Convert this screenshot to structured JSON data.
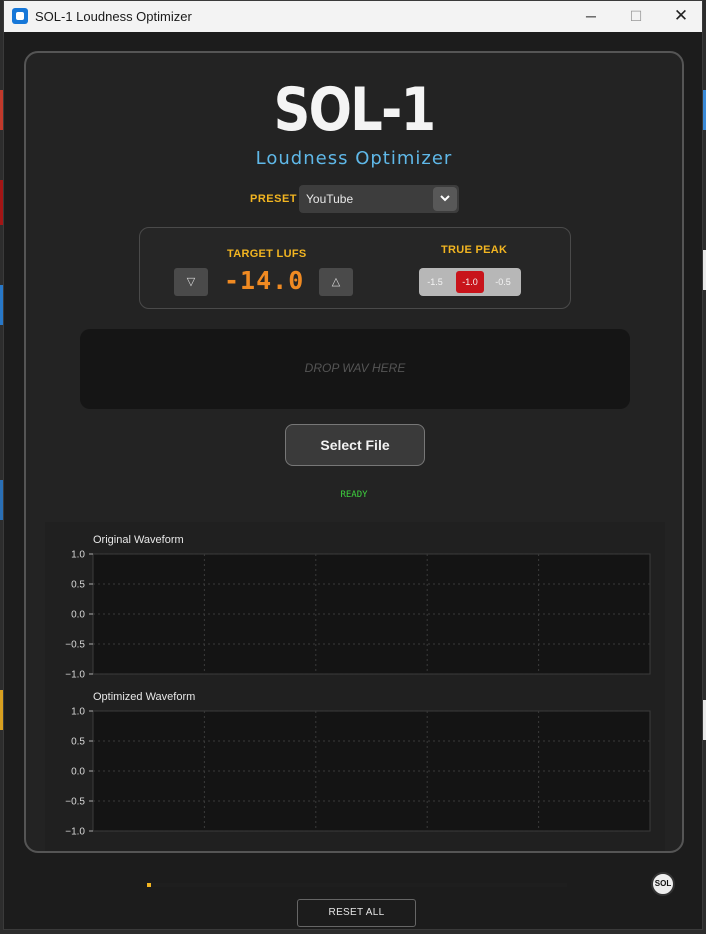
{
  "window": {
    "title": "SOL-1 Loudness Optimizer",
    "min_glyph": "─",
    "max_glyph": "☐",
    "close_glyph": "✕"
  },
  "app": {
    "logo": "SOL-1",
    "subtitle": "Loudness Optimizer"
  },
  "preset": {
    "label": "PRESET",
    "value": "YouTube"
  },
  "lufs": {
    "label": "TARGET LUFS",
    "value": "-14.0",
    "down_glyph": "▽",
    "up_glyph": "△"
  },
  "true_peak": {
    "label": "TRUE PEAK",
    "options": [
      "-1.5",
      "-1.0",
      "-0.5"
    ],
    "selected": "-1.0"
  },
  "dropzone": {
    "text": "DROP WAV HERE"
  },
  "select_file": {
    "label": "Select File"
  },
  "status": {
    "text": "READY"
  },
  "plots": [
    {
      "title": "Original Waveform",
      "yticks": [
        "1.0",
        "0.5",
        "0.0",
        "−0.5",
        "−1.0"
      ]
    },
    {
      "title": "Optimized Waveform",
      "yticks": [
        "1.0",
        "0.5",
        "0.0",
        "−0.5",
        "−1.0"
      ]
    }
  ],
  "chart_data": [
    {
      "type": "line",
      "title": "Original Waveform",
      "xlabel": "",
      "ylabel": "",
      "ylim": [
        -1.0,
        1.0
      ],
      "yticks": [
        1.0,
        0.5,
        0.0,
        -0.5,
        -1.0
      ],
      "grid": true,
      "series": []
    },
    {
      "type": "line",
      "title": "Optimized Waveform",
      "xlabel": "",
      "ylabel": "",
      "ylim": [
        -1.0,
        1.0
      ],
      "yticks": [
        1.0,
        0.5,
        0.0,
        -0.5,
        -1.0
      ],
      "grid": true,
      "series": []
    }
  ],
  "progress": {
    "fraction": 0.01
  },
  "badge": {
    "text": "SOL"
  },
  "reset": {
    "label": "RESET ALL"
  },
  "colors": {
    "accent": "#f2b521",
    "lufs_value": "#f08a22",
    "subtitle": "#5fb8e8",
    "status_ok": "#3ed13e",
    "tp_selected": "#c8141b"
  }
}
